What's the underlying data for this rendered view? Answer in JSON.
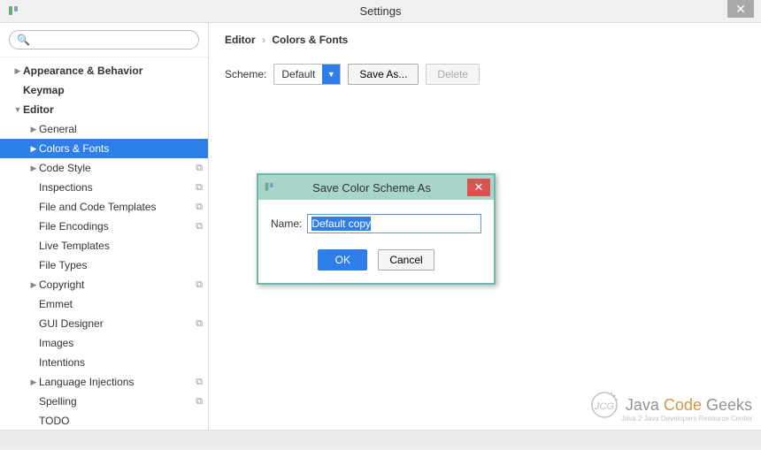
{
  "window": {
    "title": "Settings"
  },
  "search": {
    "placeholder": ""
  },
  "tree": {
    "items": [
      {
        "label": "Appearance & Behavior",
        "lvl": 0,
        "expand": "▶",
        "bold": true,
        "copy": false
      },
      {
        "label": "Keymap",
        "lvl": 0,
        "expand": "",
        "bold": true,
        "copy": false
      },
      {
        "label": "Editor",
        "lvl": 0,
        "expand": "▼",
        "bold": true,
        "copy": false
      },
      {
        "label": "General",
        "lvl": 1,
        "expand": "▶",
        "bold": false,
        "copy": false
      },
      {
        "label": "Colors & Fonts",
        "lvl": 1,
        "expand": "▶",
        "bold": false,
        "copy": false,
        "selected": true
      },
      {
        "label": "Code Style",
        "lvl": 1,
        "expand": "▶",
        "bold": false,
        "copy": true
      },
      {
        "label": "Inspections",
        "lvl": 1,
        "expand": "",
        "bold": false,
        "copy": true
      },
      {
        "label": "File and Code Templates",
        "lvl": 1,
        "expand": "",
        "bold": false,
        "copy": true
      },
      {
        "label": "File Encodings",
        "lvl": 1,
        "expand": "",
        "bold": false,
        "copy": true
      },
      {
        "label": "Live Templates",
        "lvl": 1,
        "expand": "",
        "bold": false,
        "copy": false
      },
      {
        "label": "File Types",
        "lvl": 1,
        "expand": "",
        "bold": false,
        "copy": false
      },
      {
        "label": "Copyright",
        "lvl": 1,
        "expand": "▶",
        "bold": false,
        "copy": true
      },
      {
        "label": "Emmet",
        "lvl": 1,
        "expand": "",
        "bold": false,
        "copy": false
      },
      {
        "label": "GUI Designer",
        "lvl": 1,
        "expand": "",
        "bold": false,
        "copy": true
      },
      {
        "label": "Images",
        "lvl": 1,
        "expand": "",
        "bold": false,
        "copy": false
      },
      {
        "label": "Intentions",
        "lvl": 1,
        "expand": "",
        "bold": false,
        "copy": false
      },
      {
        "label": "Language Injections",
        "lvl": 1,
        "expand": "▶",
        "bold": false,
        "copy": true
      },
      {
        "label": "Spelling",
        "lvl": 1,
        "expand": "",
        "bold": false,
        "copy": true
      },
      {
        "label": "TODO",
        "lvl": 1,
        "expand": "",
        "bold": false,
        "copy": false
      }
    ]
  },
  "breadcrumb": {
    "root": "Editor",
    "leaf": "Colors & Fonts"
  },
  "scheme": {
    "label": "Scheme:",
    "value": "Default",
    "save_as": "Save As...",
    "delete": "Delete"
  },
  "dialog": {
    "title": "Save Color Scheme As",
    "name_label": "Name:",
    "name_value": "Default copy",
    "ok": "OK",
    "cancel": "Cancel"
  },
  "watermark": {
    "brand1": "Java",
    "brand2": "Code",
    "brand3": "Geeks",
    "sub": "Java 2 Java Developers Resource Center"
  }
}
